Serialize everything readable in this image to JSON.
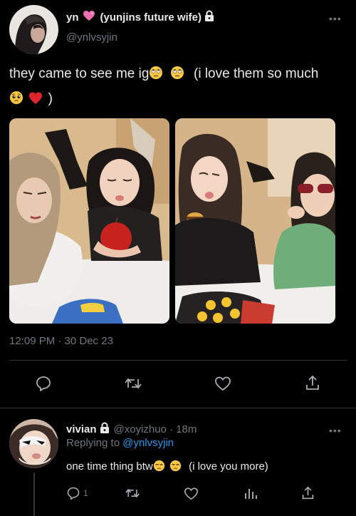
{
  "tweet": {
    "display_name": "yn",
    "display_name_suffix": "(yunjins future wife)",
    "handle": "@ynlvsyjin",
    "text_start": "they came to see me ig",
    "text_mid": "(i love them so much",
    "text_end": ")",
    "timestamp": "12:09 PM · 30 Dec 23",
    "icons": [
      "heart-emoji",
      "lock-icon",
      "rolling-eyes-emoji",
      "pleading-face-emoji",
      "red-heart-emoji"
    ]
  },
  "actions": {
    "icons": [
      "reply-icon",
      "retweet-icon",
      "like-icon",
      "share-icon"
    ]
  },
  "reply": {
    "display_name": "vivian",
    "handle": "@xoyizhuo",
    "time": "· 18m",
    "replying_prefix": "Replying to",
    "replying_to": "@ynlvsyjin",
    "text_start": "one time thing btw",
    "text_end": "(i love you more)",
    "reply_count": "1",
    "icons": [
      "reply-icon",
      "retweet-icon",
      "like-icon",
      "views-icon",
      "share-icon"
    ]
  },
  "colors": {
    "background": "#000000",
    "text": "#e7e9ea",
    "muted": "#71767b",
    "link": "#1d9bf0",
    "divider": "#2f3336"
  }
}
